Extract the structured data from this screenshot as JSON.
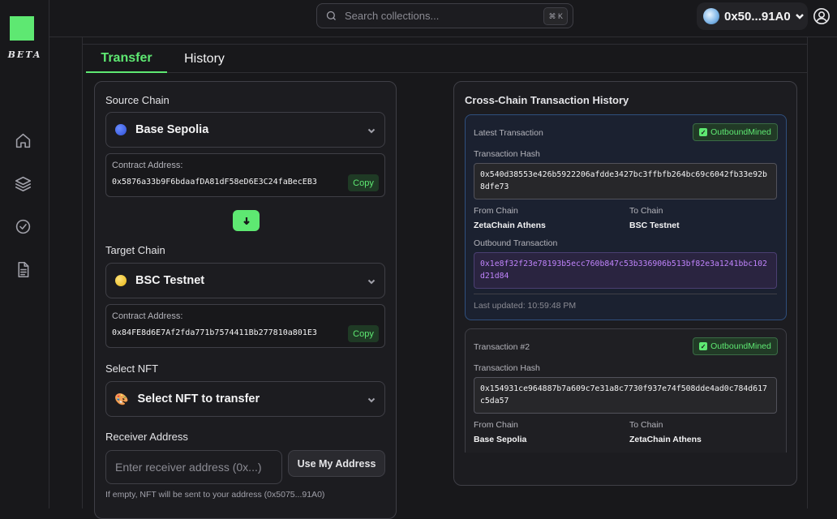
{
  "sidebar": {
    "beta_label": "BETA",
    "nav": [
      "home-icon",
      "layers-icon",
      "check-circle-icon",
      "document-icon"
    ]
  },
  "topbar": {
    "search_placeholder": "Search collections...",
    "search_shortcut": "⌘ K",
    "wallet_address": "0x50...91A0"
  },
  "tabs": [
    {
      "label": "Transfer",
      "active": true
    },
    {
      "label": "History",
      "active": false
    }
  ],
  "form": {
    "source_label": "Source Chain",
    "source_chain": "Base Sepolia",
    "source_contract_label": "Contract Address:",
    "source_contract": "0x5876a33b9F6bdaafDA81dF58eD6E3C24faBecEB3",
    "copy_label": "Copy",
    "target_label": "Target Chain",
    "target_chain": "BSC Testnet",
    "target_contract_label": "Contract Address:",
    "target_contract": "0x84FE8d6E7Af2fda771b7574411Bb277810a801E3",
    "nft_label": "Select NFT",
    "nft_select": "Select NFT to transfer",
    "receiver_label": "Receiver Address",
    "receiver_placeholder": "Enter receiver address (0x...)",
    "use_my_address": "Use My Address",
    "hint": "If empty, NFT will be sent to your address (0x5075...91A0)"
  },
  "history": {
    "title": "Cross-Chain Transaction History",
    "latest": {
      "heading": "Latest Transaction",
      "status": "OutboundMined",
      "hash_label": "Transaction Hash",
      "hash": "0x540d38553e426b5922206afdde3427bc3ffbfb264bc69c6042fb33e92b8dfe73",
      "from_label": "From Chain",
      "from": "ZetaChain Athens",
      "to_label": "To Chain",
      "to": "BSC Testnet",
      "outbound_label": "Outbound Transaction",
      "outbound": "0x1e8f32f23e78193b5ecc760b847c53b336906b513bf82e3a1241bbc102d21d84",
      "updated": "Last updated: 10:59:48 PM"
    },
    "second": {
      "heading": "Transaction #2",
      "status": "OutboundMined",
      "hash_label": "Transaction Hash",
      "hash": "0x154931ce964887b7a609c7e31a8c7730f937e74f508dde4ad0c784d617c5da57",
      "from_label": "From Chain",
      "from": "Base Sepolia",
      "to_label": "To Chain",
      "to": "ZetaChain Athens"
    }
  },
  "colors": {
    "accent": "#5ee872",
    "background": "#18181b",
    "purple_hash": "#c084fc"
  }
}
